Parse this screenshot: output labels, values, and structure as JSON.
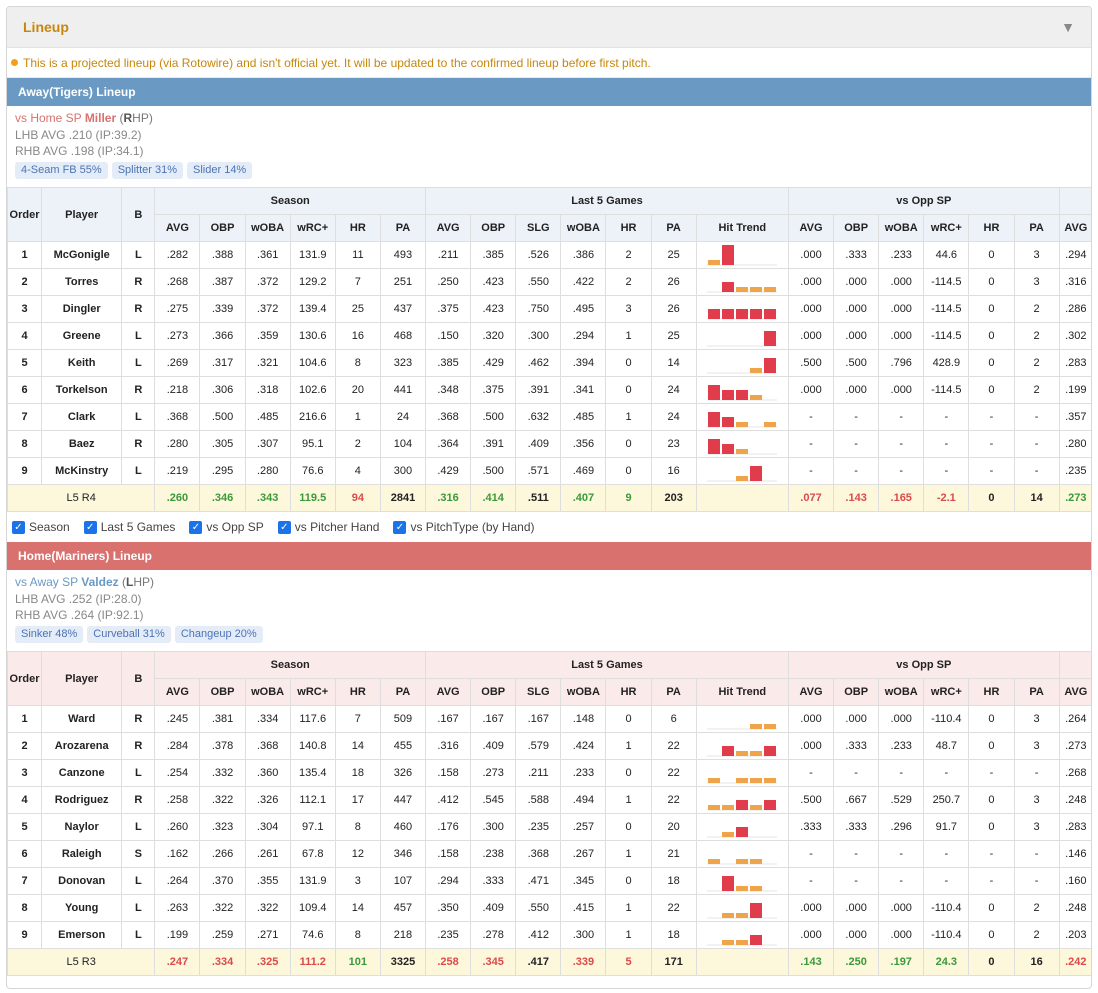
{
  "header": {
    "title": "Lineup",
    "toggle_icon": "triangle-down-icon"
  },
  "notice": "This is a projected lineup (via Rotowire) and isn't official yet. It will be updated to the confirmed lineup before first pitch.",
  "column_groups": {
    "season": "Season",
    "last5": "Last 5 Games",
    "vs_opp": "vs Opp SP"
  },
  "columns": {
    "order": "Order",
    "player": "Player",
    "bats": "B",
    "season": [
      "AVG",
      "OBP",
      "wOBA",
      "wRC+",
      "HR",
      "PA"
    ],
    "last5": [
      "AVG",
      "OBP",
      "SLG",
      "wOBA",
      "HR",
      "PA",
      "Hit Trend"
    ],
    "vs_opp": [
      "AVG",
      "OBP",
      "wOBA",
      "wRC+",
      "HR",
      "PA"
    ],
    "extra": "AVG"
  },
  "colors": {
    "trend_orange": "#f0a44a",
    "trend_red": "#e03c4b"
  },
  "filters": [
    "Season",
    "Last 5 Games",
    "vs Opp SP",
    "vs Pitcher Hand",
    "vs PitchType (by Hand)"
  ],
  "away": {
    "title": "Away(Tigers) Lineup",
    "sp_prefix": "vs Home SP",
    "sp_name": "Miller",
    "sp_hand_open": " (",
    "sp_hand_letter": "R",
    "sp_hand_rest": "HP)",
    "lhb": "LHB AVG .210 (IP:39.2)",
    "rhb": "RHB AVG .198 (IP:34.1)",
    "pitches": [
      "4-Seam FB 55%",
      "Splitter 31%",
      "Slider 14%"
    ],
    "rows": [
      {
        "order": "1",
        "player": "McGonigle",
        "b": "L",
        "season": [
          ".282",
          ".388",
          ".361",
          "131.9",
          "11",
          "493"
        ],
        "last5": [
          ".211",
          ".385",
          ".526",
          ".386",
          "2",
          "25"
        ],
        "trend": [
          1,
          4,
          0,
          0,
          0
        ],
        "vs": [
          ".000",
          ".333",
          ".233",
          "44.6",
          "0",
          "3"
        ],
        "extra": ".294"
      },
      {
        "order": "2",
        "player": "Torres",
        "b": "R",
        "season": [
          ".268",
          ".387",
          ".372",
          "129.2",
          "7",
          "251"
        ],
        "last5": [
          ".250",
          ".423",
          ".550",
          ".422",
          "2",
          "26"
        ],
        "trend": [
          0,
          2,
          1,
          1,
          1
        ],
        "vs": [
          ".000",
          ".000",
          ".000",
          "-114.5",
          "0",
          "3"
        ],
        "extra": ".316"
      },
      {
        "order": "3",
        "player": "Dingler",
        "b": "R",
        "season": [
          ".275",
          ".339",
          ".372",
          "139.4",
          "25",
          "437"
        ],
        "last5": [
          ".375",
          ".423",
          ".750",
          ".495",
          "3",
          "26"
        ],
        "trend": [
          2,
          2,
          2,
          2,
          2
        ],
        "vs": [
          ".000",
          ".000",
          ".000",
          "-114.5",
          "0",
          "2"
        ],
        "extra": ".286"
      },
      {
        "order": "4",
        "player": "Greene",
        "b": "L",
        "season": [
          ".273",
          ".366",
          ".359",
          "130.6",
          "16",
          "468"
        ],
        "last5": [
          ".150",
          ".320",
          ".300",
          ".294",
          "1",
          "25"
        ],
        "trend": [
          0,
          0,
          0,
          0,
          3
        ],
        "vs": [
          ".000",
          ".000",
          ".000",
          "-114.5",
          "0",
          "2"
        ],
        "extra": ".302"
      },
      {
        "order": "5",
        "player": "Keith",
        "b": "L",
        "season": [
          ".269",
          ".317",
          ".321",
          "104.6",
          "8",
          "323"
        ],
        "last5": [
          ".385",
          ".429",
          ".462",
          ".394",
          "0",
          "14"
        ],
        "trend": [
          0,
          0,
          0,
          1,
          3
        ],
        "vs": [
          ".500",
          ".500",
          ".796",
          "428.9",
          "0",
          "2"
        ],
        "extra": ".283"
      },
      {
        "order": "6",
        "player": "Torkelson",
        "b": "R",
        "season": [
          ".218",
          ".306",
          ".318",
          "102.6",
          "20",
          "441"
        ],
        "last5": [
          ".348",
          ".375",
          ".391",
          ".341",
          "0",
          "24"
        ],
        "trend": [
          3,
          2,
          2,
          1,
          0
        ],
        "vs": [
          ".000",
          ".000",
          ".000",
          "-114.5",
          "0",
          "2"
        ],
        "extra": ".199"
      },
      {
        "order": "7",
        "player": "Clark",
        "b": "L",
        "season": [
          ".368",
          ".500",
          ".485",
          "216.6",
          "1",
          "24"
        ],
        "last5": [
          ".368",
          ".500",
          ".632",
          ".485",
          "1",
          "24"
        ],
        "trend": [
          3,
          2,
          1,
          0,
          1
        ],
        "vs": [
          "-",
          "-",
          "-",
          "-",
          "-",
          "-"
        ],
        "extra": ".357"
      },
      {
        "order": "8",
        "player": "Baez",
        "b": "R",
        "season": [
          ".280",
          ".305",
          ".307",
          "95.1",
          "2",
          "104"
        ],
        "last5": [
          ".364",
          ".391",
          ".409",
          ".356",
          "0",
          "23"
        ],
        "trend": [
          3,
          2,
          1,
          0,
          0
        ],
        "vs": [
          "-",
          "-",
          "-",
          "-",
          "-",
          "-"
        ],
        "extra": ".280"
      },
      {
        "order": "9",
        "player": "McKinstry",
        "b": "L",
        "season": [
          ".219",
          ".295",
          ".280",
          "76.6",
          "4",
          "300"
        ],
        "last5": [
          ".429",
          ".500",
          ".571",
          ".469",
          "0",
          "16"
        ],
        "trend": [
          0,
          0,
          1,
          3,
          0
        ],
        "vs": [
          "-",
          "-",
          "-",
          "-",
          "-",
          "-"
        ],
        "extra": ".235"
      }
    ],
    "totals": {
      "label": "L5 R4",
      "season": [
        ".260",
        ".346",
        ".343",
        "119.5",
        "94",
        "2841"
      ],
      "season_c": [
        "g",
        "g",
        "g",
        "g",
        "r",
        "k"
      ],
      "last5": [
        ".316",
        ".414",
        ".511",
        ".407",
        "9",
        "203"
      ],
      "last5_c": [
        "g",
        "g",
        "k",
        "g",
        "g",
        "k"
      ],
      "vs": [
        ".077",
        ".143",
        ".165",
        "-2.1",
        "0",
        "14"
      ],
      "vs_c": [
        "r",
        "r",
        "r",
        "r",
        "k",
        "k"
      ],
      "extra": ".273",
      "extra_c": "g"
    }
  },
  "home": {
    "title": "Home(Mariners) Lineup",
    "sp_prefix": "vs Away SP",
    "sp_name": "Valdez",
    "sp_hand_open": " (",
    "sp_hand_letter": "L",
    "sp_hand_rest": "HP)",
    "lhb": "LHB AVG .252 (IP:28.0)",
    "rhb": "RHB AVG .264 (IP:92.1)",
    "pitches": [
      "Sinker 48%",
      "Curveball 31%",
      "Changeup 20%"
    ],
    "rows": [
      {
        "order": "1",
        "player": "Ward",
        "b": "R",
        "season": [
          ".245",
          ".381",
          ".334",
          "117.6",
          "7",
          "509"
        ],
        "last5": [
          ".167",
          ".167",
          ".167",
          ".148",
          "0",
          "6"
        ],
        "trend": [
          0,
          0,
          0,
          1,
          1
        ],
        "vs": [
          ".000",
          ".000",
          ".000",
          "-110.4",
          "0",
          "3"
        ],
        "extra": ".264"
      },
      {
        "order": "2",
        "player": "Arozarena",
        "b": "R",
        "season": [
          ".284",
          ".378",
          ".368",
          "140.8",
          "14",
          "455"
        ],
        "last5": [
          ".316",
          ".409",
          ".579",
          ".424",
          "1",
          "22"
        ],
        "trend": [
          0,
          2,
          1,
          1,
          2
        ],
        "vs": [
          ".000",
          ".333",
          ".233",
          "48.7",
          "0",
          "3"
        ],
        "extra": ".273"
      },
      {
        "order": "3",
        "player": "Canzone",
        "b": "L",
        "season": [
          ".254",
          ".332",
          ".360",
          "135.4",
          "18",
          "326"
        ],
        "last5": [
          ".158",
          ".273",
          ".211",
          ".233",
          "0",
          "22"
        ],
        "trend": [
          1,
          0,
          1,
          1,
          1
        ],
        "vs": [
          "-",
          "-",
          "-",
          "-",
          "-",
          "-"
        ],
        "extra": ".268"
      },
      {
        "order": "4",
        "player": "Rodriguez",
        "b": "R",
        "season": [
          ".258",
          ".322",
          ".326",
          "112.1",
          "17",
          "447"
        ],
        "last5": [
          ".412",
          ".545",
          ".588",
          ".494",
          "1",
          "22"
        ],
        "trend": [
          1,
          1,
          2,
          1,
          2
        ],
        "vs": [
          ".500",
          ".667",
          ".529",
          "250.7",
          "0",
          "3"
        ],
        "extra": ".248"
      },
      {
        "order": "5",
        "player": "Naylor",
        "b": "L",
        "season": [
          ".260",
          ".323",
          ".304",
          "97.1",
          "8",
          "460"
        ],
        "last5": [
          ".176",
          ".300",
          ".235",
          ".257",
          "0",
          "20"
        ],
        "trend": [
          0,
          1,
          2,
          0,
          0
        ],
        "vs": [
          ".333",
          ".333",
          ".296",
          "91.7",
          "0",
          "3"
        ],
        "extra": ".283"
      },
      {
        "order": "6",
        "player": "Raleigh",
        "b": "S",
        "season": [
          ".162",
          ".266",
          ".261",
          "67.8",
          "12",
          "346"
        ],
        "last5": [
          ".158",
          ".238",
          ".368",
          ".267",
          "1",
          "21"
        ],
        "trend": [
          1,
          0,
          1,
          1,
          0
        ],
        "vs": [
          "-",
          "-",
          "-",
          "-",
          "-",
          "-"
        ],
        "extra": ".146"
      },
      {
        "order": "7",
        "player": "Donovan",
        "b": "L",
        "season": [
          ".264",
          ".370",
          ".355",
          "131.9",
          "3",
          "107"
        ],
        "last5": [
          ".294",
          ".333",
          ".471",
          ".345",
          "0",
          "18"
        ],
        "trend": [
          0,
          3,
          1,
          1,
          0
        ],
        "vs": [
          "-",
          "-",
          "-",
          "-",
          "-",
          "-"
        ],
        "extra": ".160"
      },
      {
        "order": "8",
        "player": "Young",
        "b": "L",
        "season": [
          ".263",
          ".322",
          ".322",
          "109.4",
          "14",
          "457"
        ],
        "last5": [
          ".350",
          ".409",
          ".550",
          ".415",
          "1",
          "22"
        ],
        "trend": [
          0,
          1,
          1,
          3,
          0
        ],
        "vs": [
          ".000",
          ".000",
          ".000",
          "-110.4",
          "0",
          "2"
        ],
        "extra": ".248"
      },
      {
        "order": "9",
        "player": "Emerson",
        "b": "L",
        "season": [
          ".199",
          ".259",
          ".271",
          "74.6",
          "8",
          "218"
        ],
        "last5": [
          ".235",
          ".278",
          ".412",
          ".300",
          "1",
          "18"
        ],
        "trend": [
          0,
          1,
          1,
          2,
          0
        ],
        "vs": [
          ".000",
          ".000",
          ".000",
          "-110.4",
          "0",
          "2"
        ],
        "extra": ".203"
      }
    ],
    "totals": {
      "label": "L5 R3",
      "season": [
        ".247",
        ".334",
        ".325",
        "111.2",
        "101",
        "3325"
      ],
      "season_c": [
        "r",
        "r",
        "r",
        "r",
        "g",
        "k"
      ],
      "last5": [
        ".258",
        ".345",
        ".417",
        ".339",
        "5",
        "171"
      ],
      "last5_c": [
        "r",
        "r",
        "k",
        "r",
        "r",
        "k"
      ],
      "vs": [
        ".143",
        ".250",
        ".197",
        "24.3",
        "0",
        "16"
      ],
      "vs_c": [
        "g",
        "g",
        "g",
        "g",
        "k",
        "k"
      ],
      "extra": ".242",
      "extra_c": "r"
    }
  }
}
